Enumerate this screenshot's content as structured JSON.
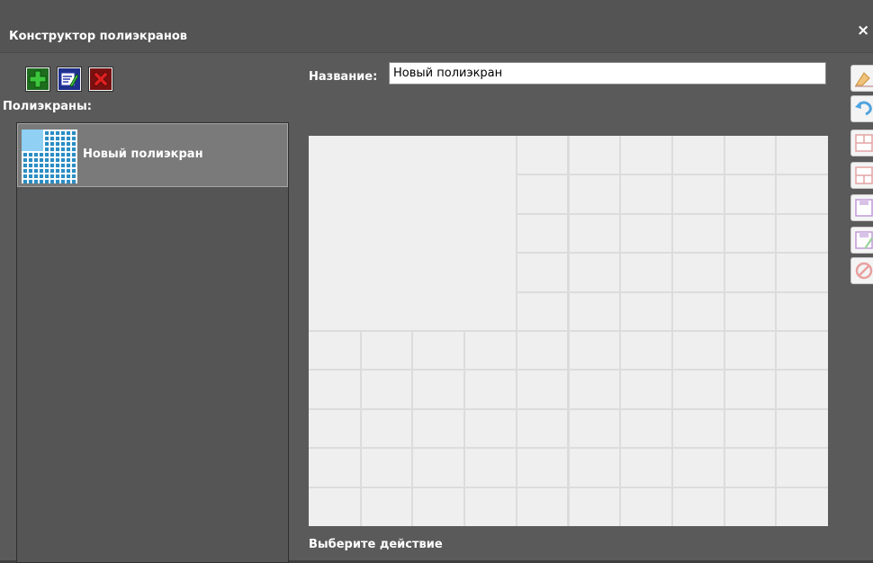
{
  "window": {
    "title": "Конструктор полиэкранов",
    "close_glyph": "×"
  },
  "toolbar": {
    "add_icon": "plus-green-icon",
    "edit_icon": "edit-icon",
    "delete_icon": "delete-red-icon"
  },
  "list": {
    "label": "Полиэкраны:",
    "items": [
      {
        "label": "Новый полиэкран"
      }
    ]
  },
  "editor": {
    "name_label": "Название:",
    "name_value": "Новый полиэкран",
    "grid": {
      "columns": 10,
      "rows": 10,
      "large_cell": {
        "cols": 4,
        "rows": 5
      }
    },
    "status": "Выберите действие"
  },
  "colors": {
    "window_bg": "#5a5a5a",
    "cell_bg": "#efefef",
    "selected_item_bg": "#7a7a7a",
    "thumbnail_blue": "#2a8dc4"
  }
}
